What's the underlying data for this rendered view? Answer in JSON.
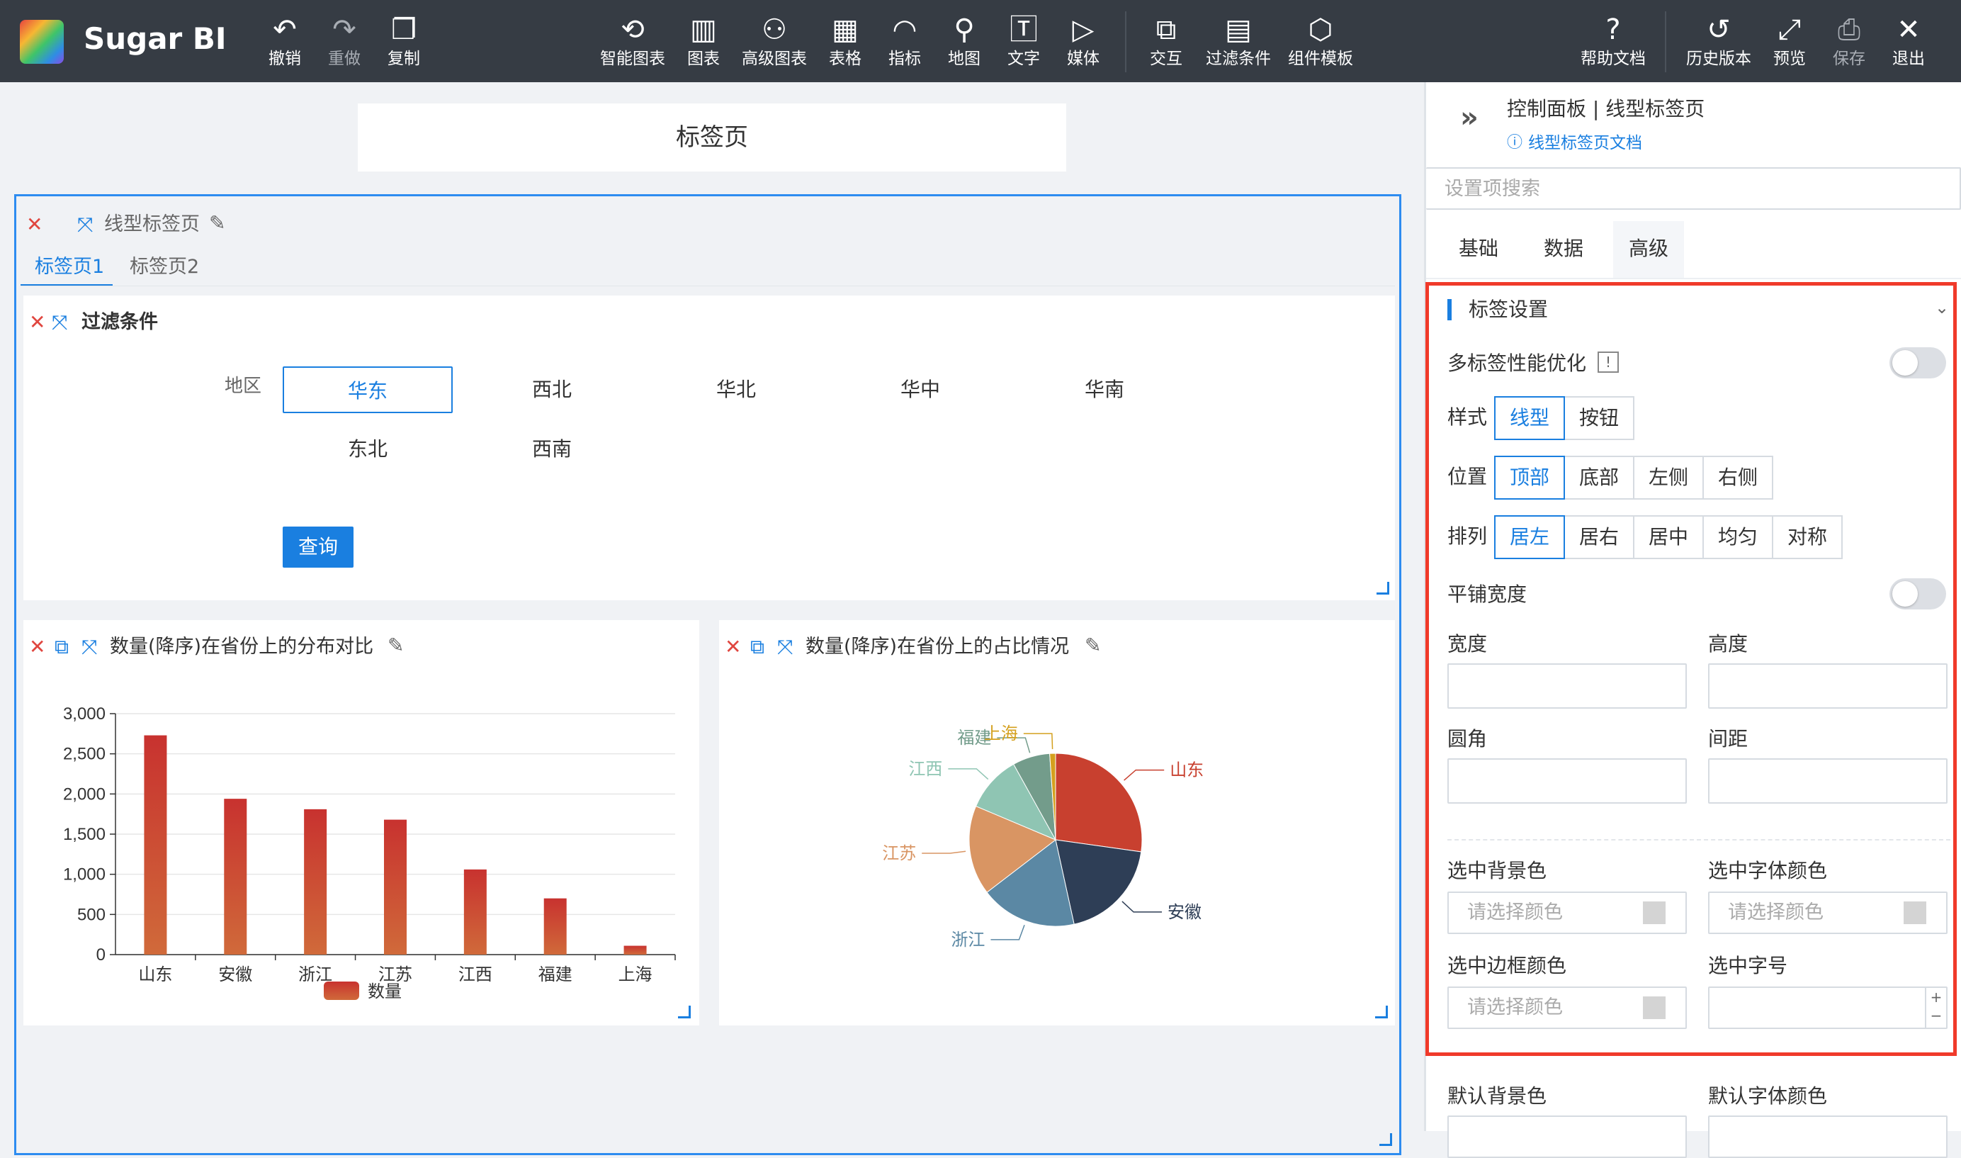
{
  "app": {
    "brand": "Sugar BI"
  },
  "toolbar": {
    "undo": "撤销",
    "redo": "重做",
    "copy": "复制",
    "smart_chart": "智能图表",
    "chart": "图表",
    "adv_chart": "高级图表",
    "table": "表格",
    "metric": "指标",
    "map": "地图",
    "text": "文字",
    "media": "媒体",
    "interaction": "交互",
    "filter": "过滤条件",
    "template": "组件模板",
    "help": "帮助文档",
    "history": "历史版本",
    "preview": "预览",
    "save": "保存",
    "exit": "退出"
  },
  "canvas": {
    "page_title": "标签页",
    "tab_component": {
      "title": "线型标签页",
      "tabs": [
        "标签页1",
        "标签页2"
      ]
    },
    "filter": {
      "title": "过滤条件",
      "field_label": "地区",
      "options": [
        "华东",
        "西北",
        "华北",
        "华中",
        "华南",
        "东北",
        "西南"
      ],
      "selected": "华东",
      "query_button": "查询"
    },
    "bar_card": {
      "title": "数量(降序)在省份上的分布对比",
      "legend": "数量"
    },
    "pie_card": {
      "title": "数量(降序)在省份上的占比情况"
    }
  },
  "chart_data": [
    {
      "type": "bar",
      "categories": [
        "山东",
        "安徽",
        "浙江",
        "江苏",
        "江西",
        "福建",
        "上海"
      ],
      "series": [
        {
          "name": "数量",
          "values": [
            2730,
            1940,
            1810,
            1680,
            1060,
            700,
            110
          ]
        }
      ],
      "yticks": [
        "0",
        "500",
        "1,000",
        "1,500",
        "2,000",
        "2,500",
        "3,000"
      ],
      "ylim": [
        0,
        3000
      ],
      "grid": true,
      "legend": "bottom-center",
      "color_top": "#c8322f",
      "color_bottom": "#d06a3a"
    },
    {
      "type": "pie",
      "labels": [
        "山东",
        "安徽",
        "浙江",
        "江苏",
        "江西",
        "福建",
        "上海"
      ],
      "values": [
        2730,
        1940,
        1810,
        1680,
        1060,
        700,
        110
      ],
      "colors": [
        "#c8402f",
        "#2e3e56",
        "#5b88a4",
        "#d99563",
        "#8fc5b3",
        "#739c8b",
        "#d4a01e"
      ]
    }
  ],
  "panel": {
    "header_title": "控制面板 | 线型标签页",
    "doc_link": "线型标签页文档",
    "search_placeholder": "设置项搜索",
    "tabs": [
      "基础",
      "数据",
      "高级"
    ],
    "active_tab": "高级",
    "section_title": "标签设置",
    "multi_tab_opt": "多标签性能优化",
    "style_label": "样式",
    "style_options": [
      "线型",
      "按钮"
    ],
    "position_label": "位置",
    "position_options": [
      "顶部",
      "底部",
      "左侧",
      "右侧"
    ],
    "align_label": "排列",
    "align_options": [
      "居左",
      "居右",
      "居中",
      "均匀",
      "对称"
    ],
    "tile_width": "平铺宽度",
    "width": "宽度",
    "height": "高度",
    "radius": "圆角",
    "spacing": "间距",
    "sel_bg": "选中背景色",
    "sel_font_color": "选中字体颜色",
    "sel_border": "选中边框颜色",
    "sel_font_size": "选中字号",
    "color_placeholder": "请选择颜色",
    "def_bg": "默认背景色",
    "def_font_color": "默认字体颜色"
  }
}
